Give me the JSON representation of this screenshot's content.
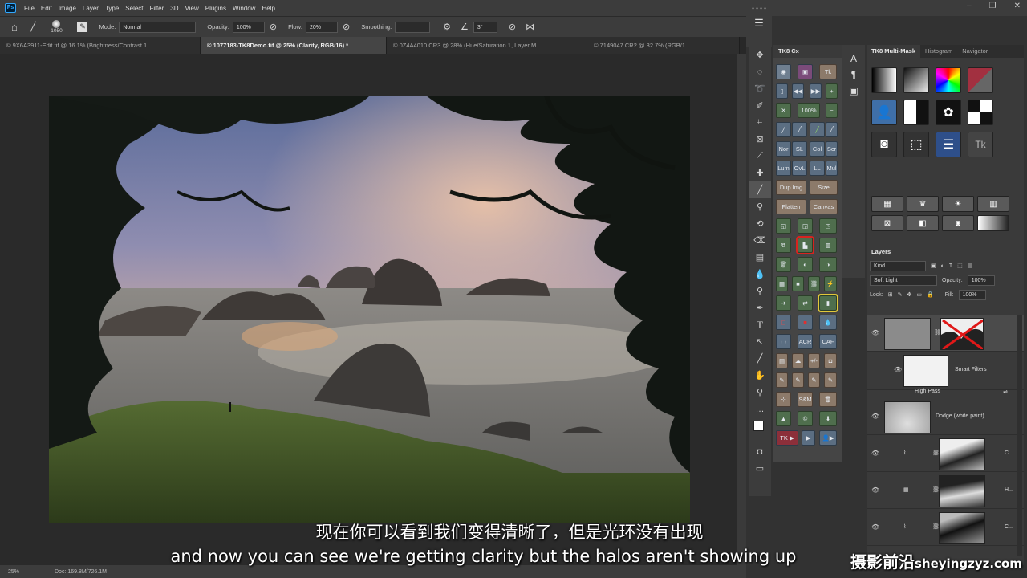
{
  "app": {
    "logo": "Ps"
  },
  "menu": [
    "File",
    "Edit",
    "Image",
    "Layer",
    "Type",
    "Select",
    "Filter",
    "3D",
    "View",
    "Plugins",
    "Window",
    "Help"
  ],
  "window_controls": [
    "–",
    "❐",
    "✕"
  ],
  "options": {
    "brush_size": "1050",
    "mode_label": "Mode:",
    "mode_value": "Normal",
    "opacity_label": "Opacity:",
    "opacity_value": "100%",
    "flow_label": "Flow:",
    "flow_value": "20%",
    "smoothing_label": "Smoothing:",
    "angle_value": "3°"
  },
  "tabs": [
    "© 9X6A3911-Edit.tif @ 16.1% (Brightness/Contrast 1 ...",
    "© 1077183-TK8Demo.tif @ 25% (Clarity, RGB/16) *",
    "© 0Z4A4010.CR3 @ 28% (Hue/Saturation 1, Layer M...",
    "© 7149047.CR2 @ 32.7% (RGB/1..."
  ],
  "status": {
    "zoom": "25%",
    "doc": "Doc: 169.8M/726.1M"
  },
  "tk8": {
    "title": "TK8 Cx",
    "buttons": {
      "pct100": "100%",
      "nor": "Nor",
      "sl": "SL",
      "col": "Col",
      "scr": "Scr",
      "lum": "Lum",
      "ovl": "OvL",
      "ll": "LL",
      "mul": "Mul",
      "dup": "Dup Img",
      "size": "Size",
      "flatten": "Flatten",
      "canvas": "Canvas",
      "acr": "ACR",
      "caf": "CAF",
      "sm": "S&M",
      "tk": "TK ▶",
      "plusminus": "+/-"
    }
  },
  "multimask": {
    "tabs": [
      "TK8 Multi-Mask",
      "Histogram",
      "Navigator"
    ]
  },
  "layers": {
    "title": "Layers",
    "filter": "Kind",
    "blend": "Soft Light",
    "opacity_label": "Opacity:",
    "opacity_value": "100%",
    "lock_label": "Lock:",
    "fill_label": "Fill:",
    "fill_value": "100%",
    "items": [
      {
        "name": ""
      },
      {
        "name": "Smart Filters"
      },
      {
        "name": "High Pass"
      },
      {
        "name": "Dodge (white paint)"
      },
      {
        "name": "C..."
      },
      {
        "name": "H..."
      },
      {
        "name": "C..."
      }
    ]
  },
  "subtitles": {
    "zh": "现在你可以看到我们变得清晰了，但是光环没有出现",
    "en": "and now you can see we're getting clarity but the halos aren't showing up"
  },
  "watermark": {
    "cn": "摄影前沿",
    "url": "sheyingzyz.com"
  }
}
